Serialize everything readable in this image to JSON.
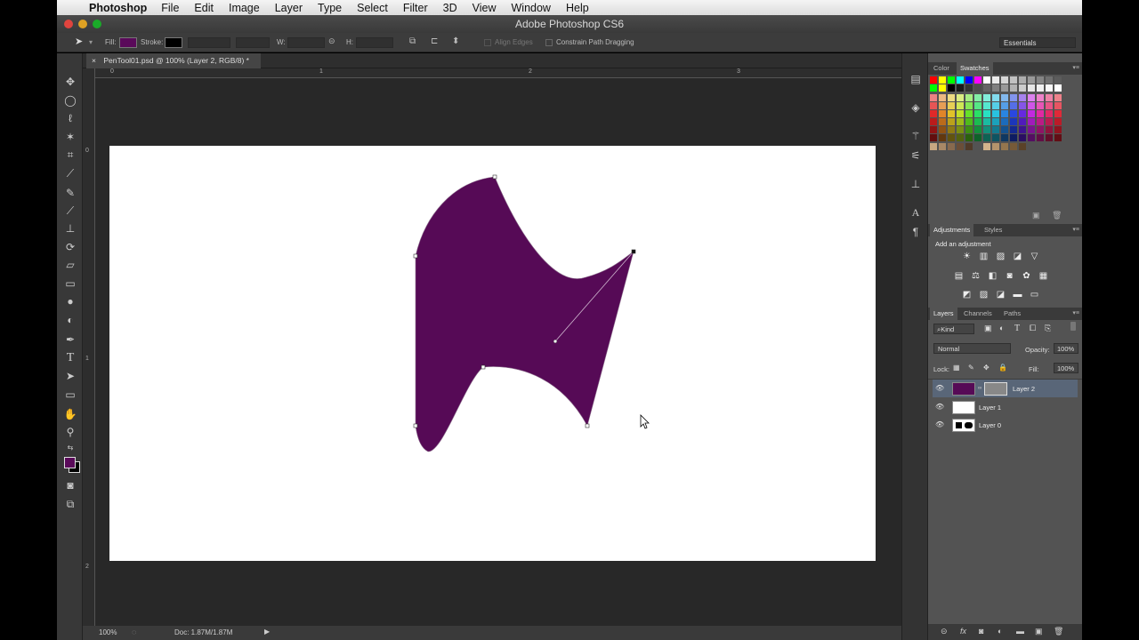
{
  "menubar": {
    "app": "Photoshop",
    "items": [
      "File",
      "Edit",
      "Image",
      "Layer",
      "Type",
      "Select",
      "Filter",
      "3D",
      "View",
      "Window",
      "Help"
    ]
  },
  "window": {
    "title": "Adobe Photoshop CS6"
  },
  "options": {
    "fill_label": "Fill:",
    "fill_color": "#5a0a5a",
    "stroke_label": "Stroke:",
    "stroke_color": "#000000",
    "w_label": "W:",
    "h_label": "H:",
    "align_edges": "Align Edges",
    "constrain": "Constrain Path Dragging",
    "workspace": "Essentials"
  },
  "document": {
    "tab_title": "PenTool01.psd @ 100% (Layer 2, RGB/8) *",
    "close_glyph": "×",
    "hruler": [
      "0",
      "1",
      "2",
      "3"
    ],
    "vruler": [
      "0",
      "1",
      "2"
    ],
    "shape_color": "#560a56"
  },
  "status": {
    "zoom": "100%",
    "doc": "Doc: 1.87M/1.87M"
  },
  "colorpanel": {
    "tabs": [
      "Color",
      "Swatches"
    ],
    "active": "Swatches"
  },
  "adjustments": {
    "tabs": [
      "Adjustments",
      "Styles"
    ],
    "heading": "Add an adjustment"
  },
  "layers": {
    "tabs": [
      "Layers",
      "Channels",
      "Paths"
    ],
    "kind": "Kind",
    "blend_mode": "Normal",
    "opacity_label": "Opacity:",
    "opacity": "100%",
    "lock_label": "Lock:",
    "fill_label": "Fill:",
    "fill": "100%",
    "rows": [
      {
        "name": "Layer 2",
        "selected": true
      },
      {
        "name": "Layer 1",
        "selected": false
      },
      {
        "name": "Layer 0",
        "selected": false
      }
    ],
    "footer_icons": [
      "link-icon",
      "fx-icon",
      "mask-icon",
      "adjustment-layer-icon",
      "group-icon",
      "new-layer-icon",
      "trash-icon"
    ]
  }
}
